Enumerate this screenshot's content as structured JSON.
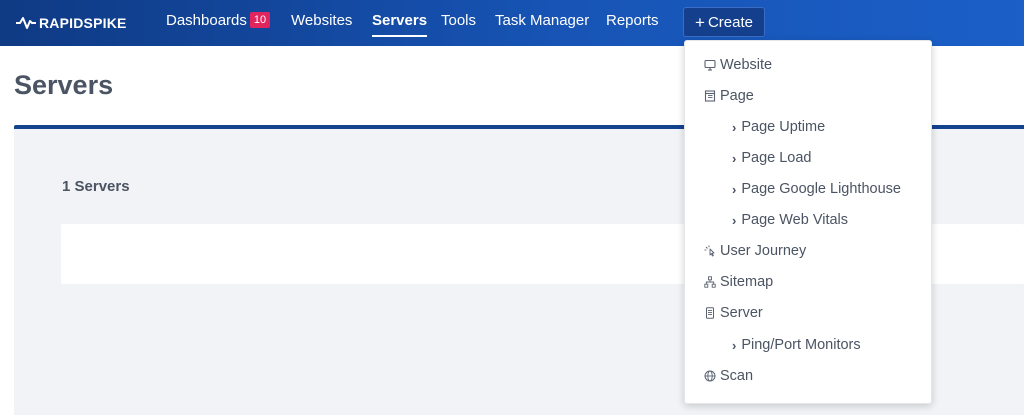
{
  "nav": {
    "logo_text": "RAPIDSPIKE",
    "items": [
      {
        "label": "Dashboards",
        "badge": "10"
      },
      {
        "label": "Websites"
      },
      {
        "label": "Servers"
      },
      {
        "label": "Tools"
      },
      {
        "label": "Task Manager"
      },
      {
        "label": "Reports"
      }
    ],
    "create_label": "Create"
  },
  "page": {
    "title": "Servers",
    "count_label": "1 Servers"
  },
  "dropdown": {
    "items": [
      {
        "label": "Website",
        "icon": "monitor-icon"
      },
      {
        "label": "Page",
        "icon": "page-icon"
      },
      {
        "label": "Page Uptime"
      },
      {
        "label": "Page Load"
      },
      {
        "label": "Page Google Lighthouse"
      },
      {
        "label": "Page Web Vitals"
      },
      {
        "label": "User Journey",
        "icon": "pointer-icon"
      },
      {
        "label": "Sitemap",
        "icon": "sitemap-icon"
      },
      {
        "label": "Server",
        "icon": "server-icon"
      },
      {
        "label": "Ping/Port Monitors"
      },
      {
        "label": "Scan",
        "icon": "globe-icon"
      }
    ]
  },
  "colors": {
    "nav_dark": "#0f3a84",
    "nav_light": "#1b5fc7",
    "badge": "#e0245e",
    "title_bar": "#13428f",
    "text": "#4b5463",
    "content_bg": "#f2f3f6"
  }
}
